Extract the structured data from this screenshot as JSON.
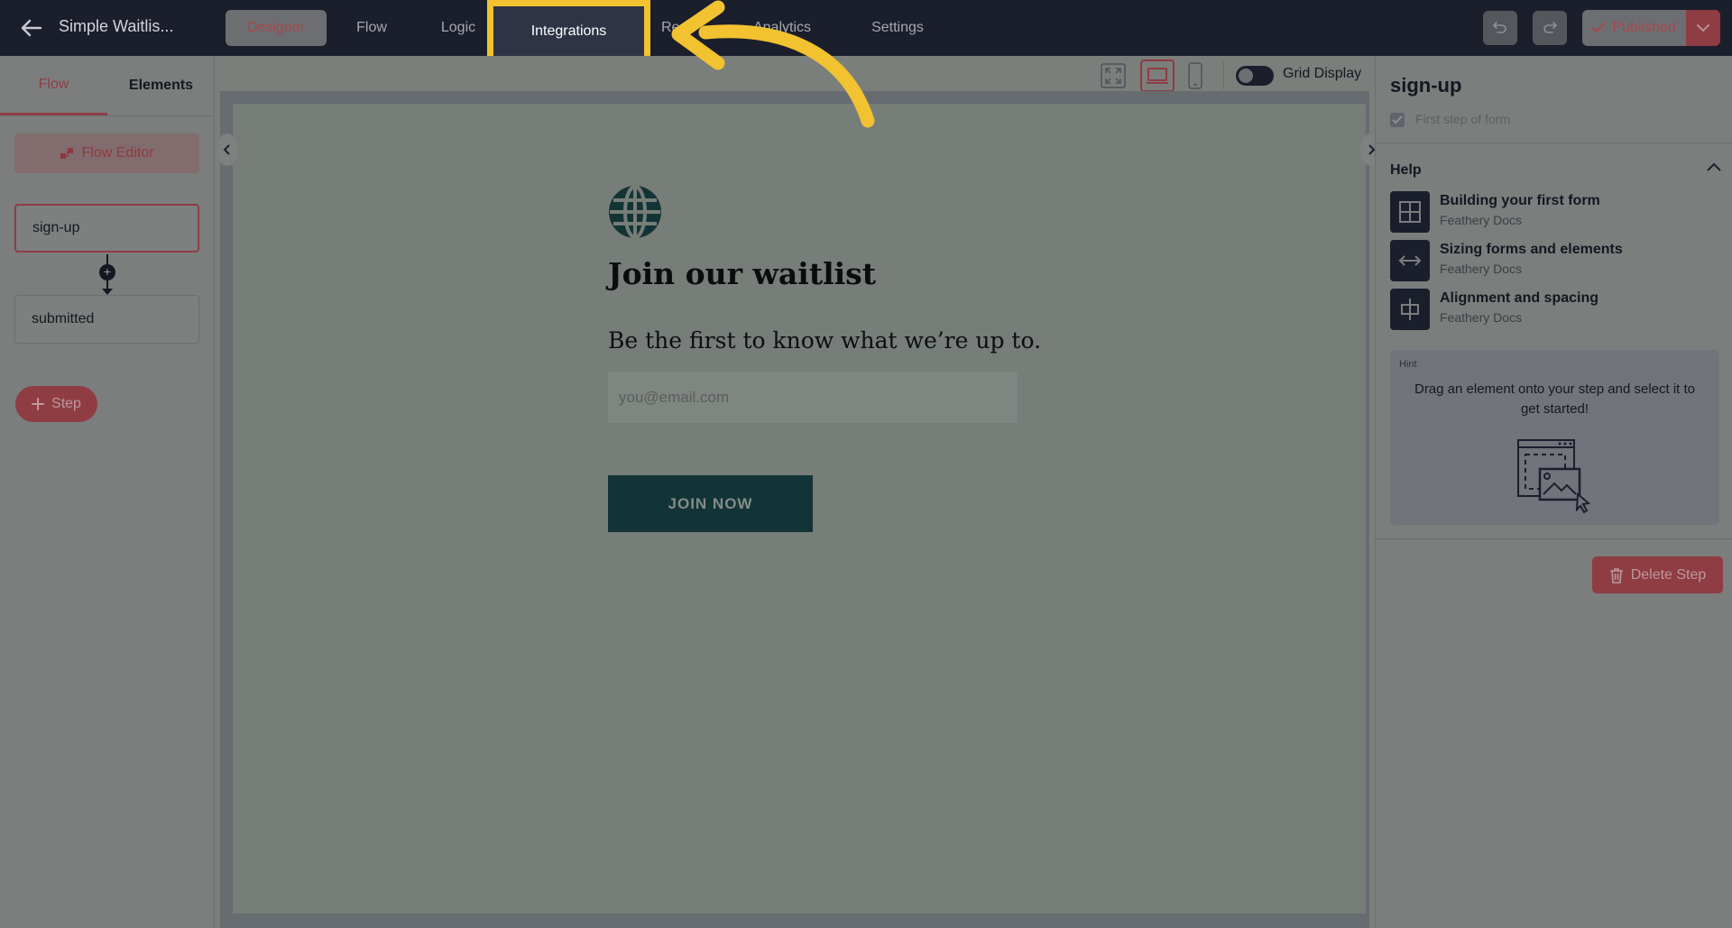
{
  "header": {
    "form_title": "Simple Waitlis...",
    "tabs": [
      {
        "label": "Designer"
      },
      {
        "label": "Flow"
      },
      {
        "label": "Logic"
      },
      {
        "label": "Integrations"
      },
      {
        "label": "Re"
      },
      {
        "label": "Analytics"
      },
      {
        "label": "Settings"
      }
    ],
    "publish_label": "Published"
  },
  "left_panel": {
    "tabs": [
      "Flow",
      "Elements"
    ],
    "flow_editor_label": "Flow Editor",
    "steps": [
      "sign-up",
      "submitted"
    ],
    "add_step_label": "Step",
    "connector_plus": "+"
  },
  "canvas": {
    "grid_display_label": "Grid Display",
    "grid_display_on": false,
    "form": {
      "title": "Join our waitlist",
      "subtitle": "Be the first to know what we’re up to.",
      "email_placeholder": "you@email.com",
      "button_label": "JOIN NOW",
      "accent_color": "#133436"
    }
  },
  "right_panel": {
    "step_name": "sign-up",
    "first_step_label": "First step of form",
    "first_step_checked": true,
    "help_label": "Help",
    "help_items": [
      {
        "title": "Building your first form",
        "source": "Feathery Docs",
        "icon": "layout-icon"
      },
      {
        "title": "Sizing forms and elements",
        "source": "Feathery Docs",
        "icon": "resize-icon"
      },
      {
        "title": "Alignment and spacing",
        "source": "Feathery Docs",
        "icon": "align-icon"
      }
    ],
    "hint_tag": "Hint",
    "hint_text": "Drag an element onto your step and select it to get started!",
    "delete_step_label": "Delete Step"
  },
  "colors": {
    "brand_red": "#8f3c43",
    "highlight_yellow": "#f2c230",
    "topbar": "#1b1f2c"
  }
}
